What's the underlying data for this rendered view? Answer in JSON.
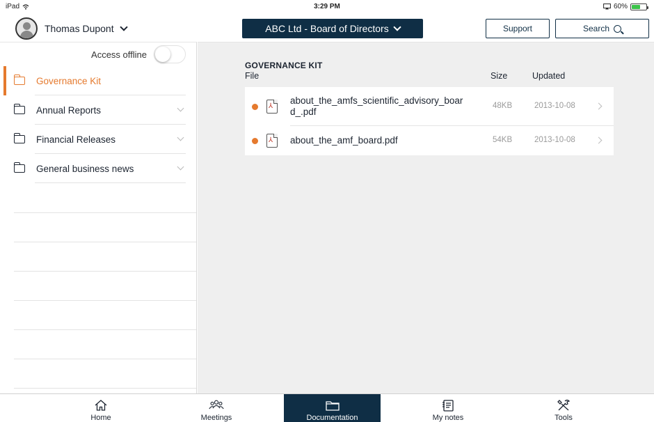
{
  "status_bar": {
    "device": "iPad",
    "time": "3:29 PM",
    "battery": "60%",
    "battery_level": 0.6
  },
  "header": {
    "user_name": "Thomas Dupont",
    "board_title": "ABC Ltd - Board of Directors",
    "support_label": "Support",
    "search_label": "Search"
  },
  "sidebar": {
    "offline_label": "Access offline",
    "offline_enabled": false,
    "items": [
      {
        "label": "Governance Kit",
        "active": true
      },
      {
        "label": "Annual Reports",
        "active": false
      },
      {
        "label": "Financial Releases",
        "active": false
      },
      {
        "label": "General business news",
        "active": false
      }
    ]
  },
  "main": {
    "section_title": "GOVERNANCE KIT",
    "columns": {
      "file": "File",
      "size": "Size",
      "updated": "Updated"
    },
    "files": [
      {
        "name": "about_the_amfs_scientific_advisory_boar d_.pdf",
        "size": "48KB",
        "updated": "2013-10-08",
        "unread": true
      },
      {
        "name": "about_the_amf_board.pdf",
        "size": "54KB",
        "updated": "2013-10-08",
        "unread": true
      }
    ]
  },
  "tabbar": {
    "tabs": [
      {
        "label": "Home",
        "icon": "home-icon",
        "active": false
      },
      {
        "label": "Meetings",
        "icon": "people-icon",
        "active": false
      },
      {
        "label": "Documentation",
        "icon": "folder-icon",
        "active": true
      },
      {
        "label": "My notes",
        "icon": "notes-icon",
        "active": false
      },
      {
        "label": "Tools",
        "icon": "tools-icon",
        "active": false
      }
    ]
  },
  "colors": {
    "accent": "#e57a2e",
    "navy": "#0f2e45",
    "battery_green": "#3cc34b"
  }
}
